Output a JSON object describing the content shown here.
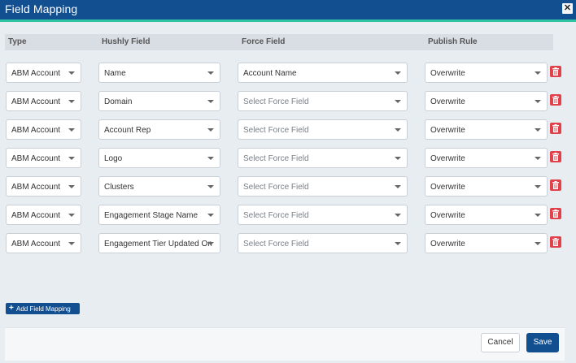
{
  "dialog": {
    "title": "Field Mapping",
    "close_icon": "close-icon",
    "accent_color": "#2fc2a3",
    "brand_color": "#124f91"
  },
  "table": {
    "headers": [
      "Type",
      "Hushly Field",
      "Force Field",
      "Publish Rule"
    ],
    "rows": [
      {
        "type": "ABM Account",
        "hushly_field": "Name",
        "force_field": "Account Name",
        "publish_rule": "Overwrite"
      },
      {
        "type": "ABM Account",
        "hushly_field": "Domain",
        "force_field": "Select Force Field",
        "publish_rule": "Overwrite"
      },
      {
        "type": "ABM Account",
        "hushly_field": "Account Rep",
        "force_field": "Select Force Field",
        "publish_rule": "Overwrite"
      },
      {
        "type": "ABM Account",
        "hushly_field": "Logo",
        "force_field": "Select Force Field",
        "publish_rule": "Overwrite"
      },
      {
        "type": "ABM Account",
        "hushly_field": "Clusters",
        "force_field": "Select Force Field",
        "publish_rule": "Overwrite"
      },
      {
        "type": "ABM Account",
        "hushly_field": "Engagement Stage Name",
        "force_field": "Select Force Field",
        "publish_rule": "Overwrite"
      },
      {
        "type": "ABM Account",
        "hushly_field": "Engagement Tier Updated On",
        "force_field": "Select Force Field",
        "publish_rule": "Overwrite"
      }
    ],
    "delete_icon": "trash-icon",
    "delete_color": "#e0414b"
  },
  "actions": {
    "add_label": "Add Field Mapping",
    "add_icon": "plus-icon",
    "cancel_label": "Cancel",
    "save_label": "Save"
  }
}
